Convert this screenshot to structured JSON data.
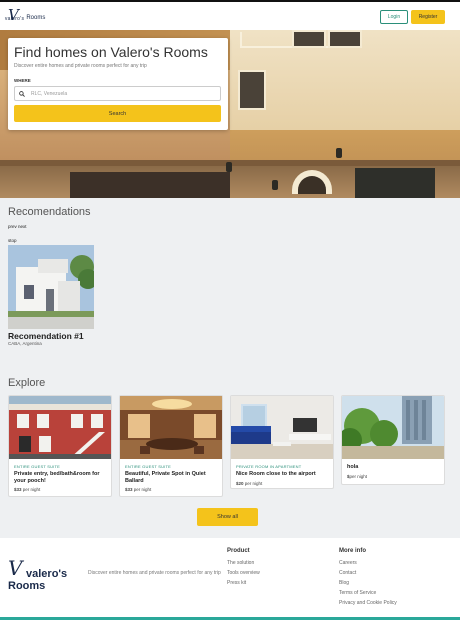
{
  "nav": {
    "logo_mark": "V",
    "logo_small": "valero's",
    "logo_text": "Rooms",
    "login_label": "Login",
    "register_label": "Register"
  },
  "hero": {
    "title": "Find homes on Valero's Rooms",
    "subtitle": "Discover entire homes and private rooms perfect for any trip",
    "where_label": "WHERE",
    "search_placeholder": "RLC, Venezuela",
    "search_button": "Search"
  },
  "recommendations": {
    "heading": "Recomendations",
    "prevnext": "prev next",
    "stop": "stop",
    "items": [
      {
        "title": "Recomendation #1",
        "location": "CABA, Argentina"
      }
    ]
  },
  "explore": {
    "heading": "Explore",
    "cards": [
      {
        "type": "Entire guest suite",
        "title": "Private entry, bed/bath&room for your pooch!",
        "price_amount": "$33",
        "price_unit": "per night"
      },
      {
        "type": "Entire guest suite",
        "title": "Beautiful, Private Spot in Quiet Ballard",
        "price_amount": "$33",
        "price_unit": "per night"
      },
      {
        "type": "Private room in apartment",
        "title": "Nice Room close to the airport",
        "price_amount": "$20",
        "price_unit": "per night"
      },
      {
        "type": "",
        "title": "hola",
        "price_amount": "$",
        "price_unit": "per night"
      }
    ],
    "show_all": "Show all"
  },
  "footer": {
    "logo_mark": "V",
    "logo_line1": "valero's",
    "logo_line2": "Rooms",
    "tagline": "Discover entire homes and private rooms perfect for any trip",
    "product_title": "Product",
    "product_links": [
      "The solution",
      "Tools overview",
      "Press kit"
    ],
    "more_title": "More info",
    "more_links": [
      "Careers",
      "Contact",
      "Blog",
      "Terms of Service",
      "Privacy and Cookie Policy"
    ]
  },
  "colors": {
    "accent_yellow": "#f4c31b",
    "accent_teal": "#2a8f7a",
    "section_gray": "#eef0f2"
  },
  "icons": {
    "search": "magnifier-icon"
  }
}
